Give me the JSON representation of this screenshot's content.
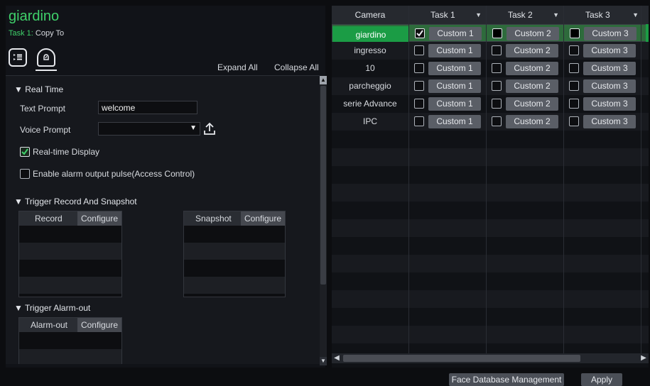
{
  "header": {
    "camera_name": "giardino",
    "task_prefix": "Task 1:",
    "task_action": "Copy To"
  },
  "toolbar": {
    "expand_all": "Expand All",
    "collapse_all": "Collapse All",
    "list_icon": "list-icon",
    "alarm_icon": "alarm-bell-icon"
  },
  "real_time": {
    "section_title": "▼ Real Time",
    "text_prompt_label": "Text Prompt",
    "text_prompt_value": "welcome",
    "voice_prompt_label": "Voice Prompt",
    "voice_prompt_value": "",
    "realtime_display_label": "Real-time Display",
    "realtime_display_checked": true,
    "alarm_pulse_label": "Enable alarm output pulse(Access Control)",
    "alarm_pulse_checked": false
  },
  "trigger_record": {
    "section_title": "▼ Trigger Record And Snapshot",
    "record_header": "Record",
    "snapshot_header": "Snapshot",
    "configure_label": "Configure"
  },
  "trigger_alarm": {
    "section_title": "▼ Trigger Alarm-out",
    "alarm_header": "Alarm-out",
    "configure_label": "Configure"
  },
  "table": {
    "headers": {
      "camera": "Camera",
      "task1": "Task 1",
      "task2": "Task 2",
      "task3": "Task 3"
    },
    "custom_labels": [
      "Custom 1",
      "Custom 2",
      "Custom 3"
    ],
    "rows": [
      {
        "camera": "giardino",
        "selected": true
      },
      {
        "camera": "ingresso",
        "selected": false
      },
      {
        "camera": "10",
        "selected": false
      },
      {
        "camera": "parcheggio",
        "selected": false
      },
      {
        "camera": "serie Advance",
        "selected": false
      },
      {
        "camera": "IPC",
        "selected": false
      }
    ]
  },
  "footer": {
    "face_db": "Face Database Management",
    "apply": "Apply"
  },
  "colors": {
    "accent_green": "#1b9c45",
    "title_green": "#3fd06a"
  }
}
